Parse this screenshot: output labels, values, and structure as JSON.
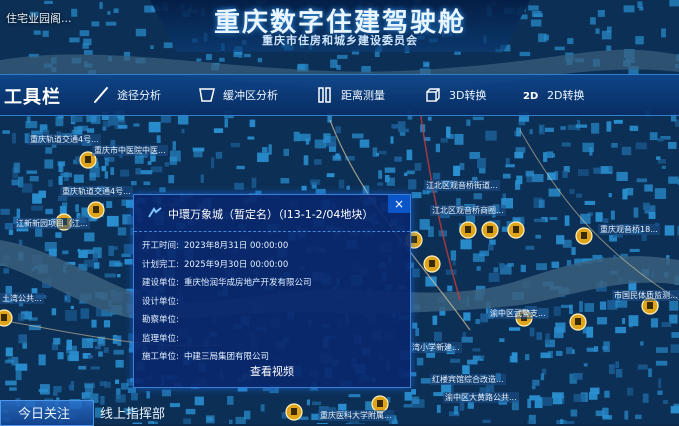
{
  "header": {
    "title": "重庆数字住建驾驶舱",
    "subtitle": "重庆市住房和城乡建设委员会",
    "corner_label": "住宅业园阁..."
  },
  "toolbar": {
    "title": "工具栏",
    "tools": [
      {
        "label": "途径分析",
        "icon": "path-analysis-icon"
      },
      {
        "label": "缓冲区分析",
        "icon": "buffer-analysis-icon"
      },
      {
        "label": "距离测量",
        "icon": "distance-measure-icon"
      },
      {
        "label": "3D转换",
        "icon": "cube-3d-icon"
      },
      {
        "label": "2D转换",
        "icon": "2d-switch-icon"
      }
    ]
  },
  "popup": {
    "title": "中環万象城（暂定名）（I13-1-2/04地块）",
    "close": "×",
    "rows": [
      {
        "key": "开工时间:",
        "value": "2023年8月31日 00:00:00"
      },
      {
        "key": "计划完工:",
        "value": "2025年9月30日 00:00:00"
      },
      {
        "key": "建设单位:",
        "value": "重庆怡润华成房地产开发有限公司"
      },
      {
        "key": "设计单位:",
        "value": ""
      },
      {
        "key": "勘察单位:",
        "value": ""
      },
      {
        "key": "监理单位:",
        "value": ""
      },
      {
        "key": "施工单位:",
        "value": "中建三局集团有限公司"
      }
    ],
    "footer": "查看视频"
  },
  "map_labels": [
    "重庆轨道交通4号...",
    "重庆市中医院中医...",
    "重庆轨道交通4号...",
    "江新新园项目（江...",
    "土湾公共...",
    "江北区观音桥街道...",
    "重庆观音桥18...",
    "江北区观音桥商圈...",
    "市国民体质监测...",
    "渝中区武警支...",
    "红楼宾馆综合改造...",
    "渝中区大黄路公共...",
    "重庆医科大学附属...",
    "湾小学新建..."
  ],
  "bottom_tabs": {
    "tab1": "今日关注",
    "tab2": "线上指挥部"
  },
  "colors": {
    "accent": "#0a56c8",
    "map_base": "#0b2a4e",
    "building": "#2a8fd0",
    "marker": "#e0a41a"
  }
}
